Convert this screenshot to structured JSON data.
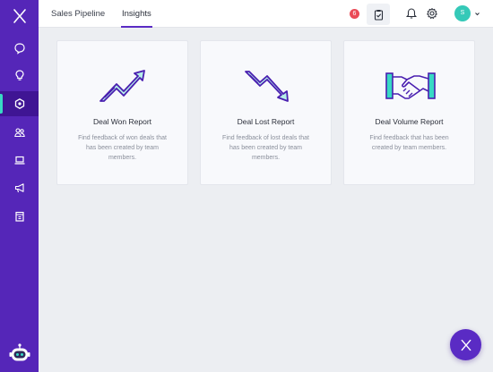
{
  "topbar": {
    "tabs": [
      {
        "label": "Sales Pipeline"
      },
      {
        "label": "Insights"
      }
    ],
    "active_tab": "Insights",
    "notification_count": "6",
    "avatar_initial": "S"
  },
  "sidebar": {
    "items": [
      {
        "icon": "chat-icon"
      },
      {
        "icon": "lightbulb-icon"
      },
      {
        "icon": "insights-icon",
        "active": true
      },
      {
        "icon": "contacts-icon"
      },
      {
        "icon": "laptop-icon"
      },
      {
        "icon": "megaphone-icon"
      },
      {
        "icon": "calendar-icon"
      }
    ]
  },
  "cards": [
    {
      "title": "Deal Won Report",
      "description": "Find feedback of won deals that has been created by team members.",
      "icon": "trend-up-icon"
    },
    {
      "title": "Deal Lost Report",
      "description": "Find feedback of lost deals that has been created by team members.",
      "icon": "trend-down-icon"
    },
    {
      "title": "Deal Volume Report",
      "description": "Find feedback that has been created by team members.",
      "icon": "handshake-icon"
    }
  ],
  "colors": {
    "sidebar": "#5526b8",
    "sidebar_active": "#3f1594",
    "accent_teal": "#38d9c4",
    "brand_purple": "#5a2bc4",
    "badge_red": "#ea4b57"
  }
}
